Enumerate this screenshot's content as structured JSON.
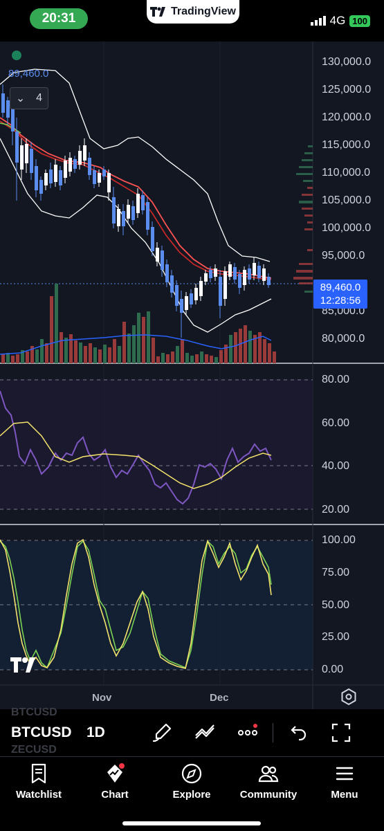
{
  "status_bar": {
    "time": "20:31",
    "app_pill": "TradingView",
    "network": "4G",
    "battery": "100"
  },
  "chart": {
    "last_price_top": "89,460.0",
    "collapse_count": "4",
    "price_axis": [
      "130,000.0",
      "125,000.0",
      "120,000.0",
      "115,000.0",
      "110,000.0",
      "105,000.0",
      "100,000.0",
      "95,000.0",
      "85,000.0",
      "80,000.0"
    ],
    "last_price": "89,460.0",
    "countdown": "12:28:56",
    "rsi_axis": [
      "80.00",
      "60.00",
      "40.00",
      "20.00"
    ],
    "stoch_axis": [
      "100.00",
      "75.00",
      "50.00",
      "25.00",
      "0.00"
    ],
    "dates": [
      "Nov",
      "Dec"
    ]
  },
  "toolbar": {
    "ghost_top": "BTCUSD",
    "symbol": "BTCUSD",
    "interval": "1D",
    "ghost_bottom": "ZECUSD"
  },
  "tabs": [
    {
      "label": "Watchlist"
    },
    {
      "label": "Chart"
    },
    {
      "label": "Explore"
    },
    {
      "label": "Community"
    },
    {
      "label": "Menu"
    }
  ],
  "colors": {
    "up": "#5b8def",
    "down": "#ffffff",
    "ema_fast": "#ff5252",
    "ema_slow": "#d32f2f",
    "rsi": "#7e57c2",
    "rsi_ma": "#f4e36b",
    "stoch_k": "#f4e36b",
    "stoch_d": "#7bd152"
  }
}
